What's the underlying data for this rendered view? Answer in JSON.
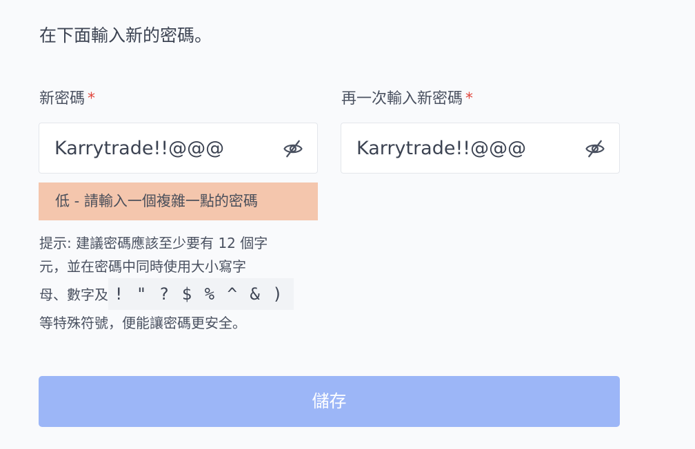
{
  "intro": "在下面輸入新的密碼。",
  "new_password": {
    "label": "新密碼",
    "required_mark": "*",
    "value": "Karrytrade!!@@@",
    "toggle_icon": "eye-off-icon"
  },
  "confirm_password": {
    "label": "再一次輸入新密碼",
    "required_mark": "*",
    "value": "Karrytrade!!@@@",
    "toggle_icon": "eye-off-icon"
  },
  "strength": {
    "text": "低 - 請輸入一個複雜一點的密碼",
    "color": "#f4c6ad"
  },
  "hint": {
    "line1": "提示: 建議密碼應該至少要有 12 個字",
    "line2": "元，並在密碼中同時使用大小寫字",
    "line3_prefix": "母、數字及",
    "symbols": "! \" ? $ % ^ & )",
    "line4": "等特殊符號，便能讓密碼更安全。"
  },
  "save_button": {
    "label": "儲存",
    "color": "#9cb6f7"
  }
}
